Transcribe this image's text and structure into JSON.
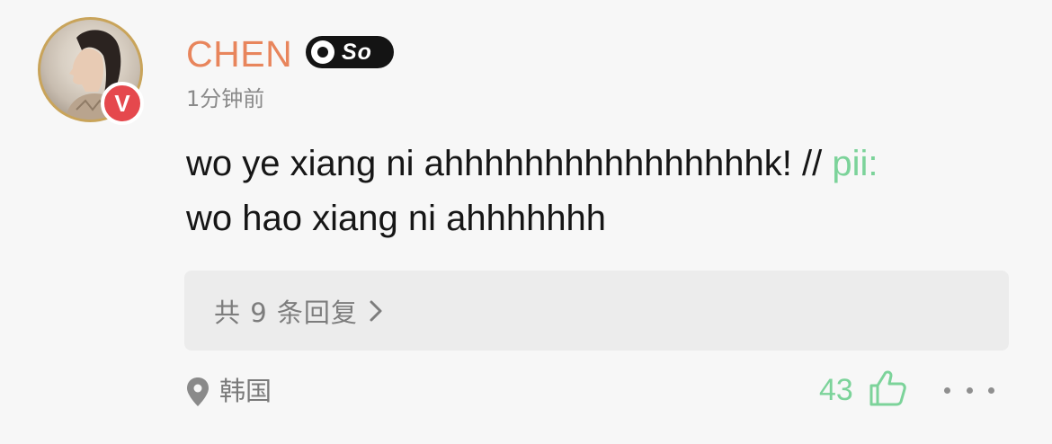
{
  "comment": {
    "username": "CHEN",
    "verified_mark": "V",
    "level_badge": "So",
    "time": "1分钟前",
    "text_main": "wo ye xiang ni ahhhhhhhhhhhhhhhhk! // ",
    "mention": "pii:",
    "text_quoted": "wo hao xiang ni ahhhhhhh",
    "replies_label": "共 9 条回复",
    "location": "韩国",
    "likes": "43"
  },
  "colors": {
    "username": "#e8855c",
    "mention": "#7cd39a",
    "likes": "#7cd39a",
    "verify_badge": "#e5484d",
    "avatar_ring": "#c9a45a"
  },
  "icons": {
    "verify": "verified-v-icon",
    "level": "level-badge-icon",
    "reply_arrow": "chevron-right-icon",
    "location": "location-pin-icon",
    "like": "thumbs-up-icon",
    "more": "more-dots-icon"
  }
}
